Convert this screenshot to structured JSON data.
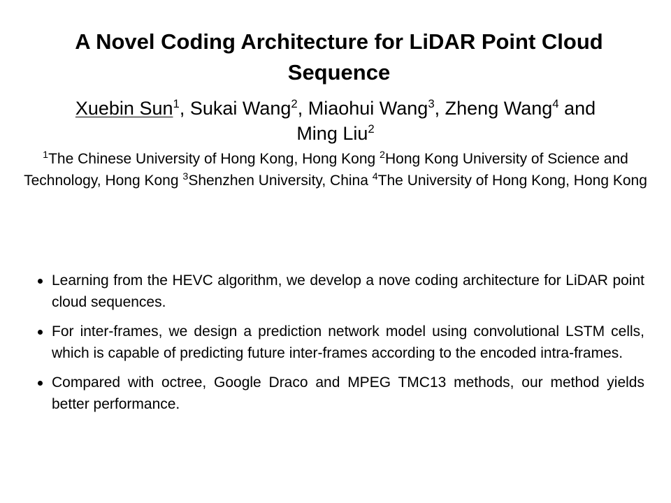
{
  "title": "A Novel Coding Architecture for LiDAR Point Cloud Sequence",
  "authors": [
    {
      "name": "Xuebin Sun",
      "sup": "1",
      "sep": ", ",
      "underlined": true
    },
    {
      "name": "Sukai Wang",
      "sup": "2",
      "sep": ", ",
      "underlined": false
    },
    {
      "name": "Miaohui Wang",
      "sup": "3",
      "sep": ", ",
      "underlined": false
    },
    {
      "name": "Zheng Wang",
      "sup": "4",
      "sep": " and ",
      "underlined": false
    },
    {
      "name": "Ming Liu",
      "sup": "2",
      "sep": "",
      "underlined": false
    }
  ],
  "affiliations": [
    {
      "sup": "1",
      "text": "The Chinese University of Hong Kong, Hong Kong  "
    },
    {
      "sup": "2",
      "text": "Hong Kong University of Science and Technology, Hong Kong  "
    },
    {
      "sup": "3",
      "text": "Shenzhen University, China "
    },
    {
      "sup": "4",
      "text": "The University of Hong Kong, Hong Kong"
    }
  ],
  "bullets": [
    "Learning from the HEVC algorithm, we develop a nove coding architecture for LiDAR point cloud sequences.",
    "For inter-frames, we design a prediction network model using convolutional LSTM cells, which is capable of predicting future inter-frames according to the encoded intra-frames.",
    "Compared with octree, Google Draco and MPEG TMC13 methods, our method yields better performance."
  ]
}
